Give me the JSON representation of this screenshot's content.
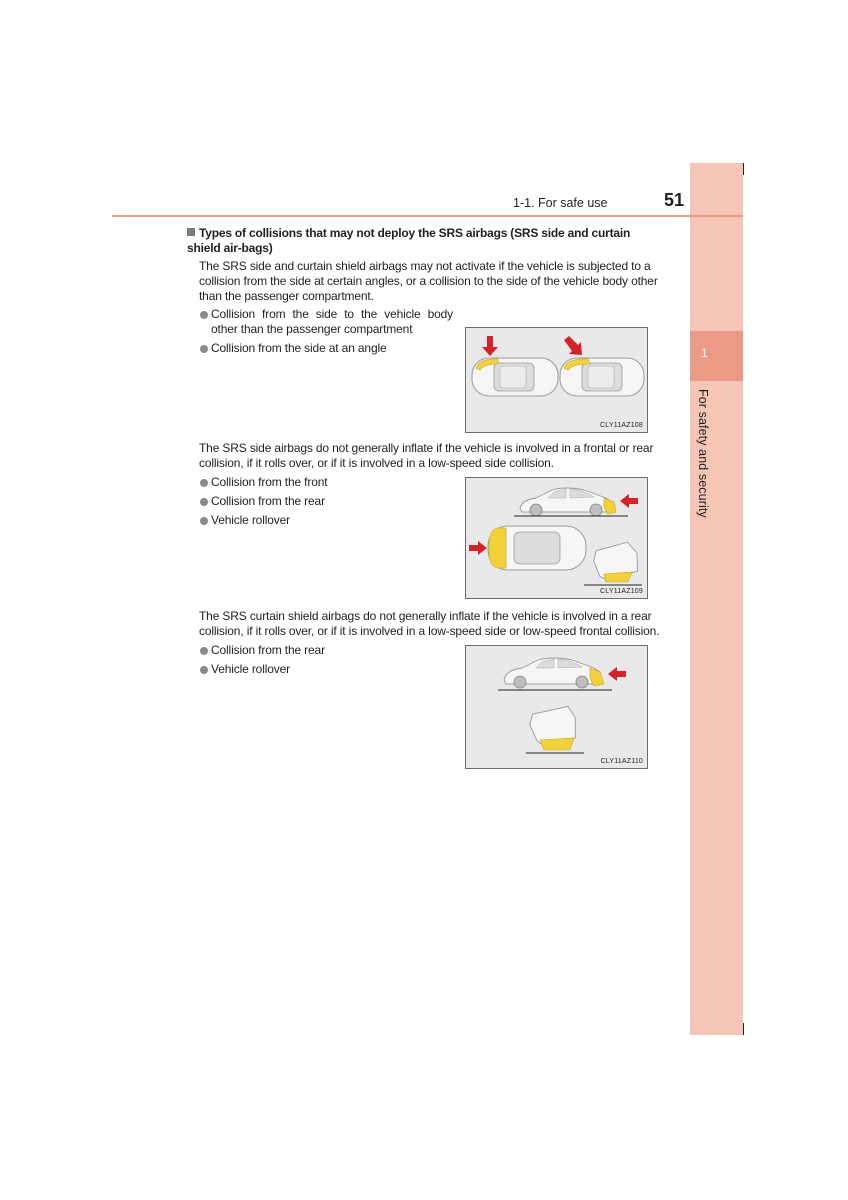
{
  "header": {
    "section": "1-1. For safe use",
    "page_number": "51"
  },
  "sidebar": {
    "chapter_number": "1",
    "chapter_title": "For safety and security"
  },
  "content": {
    "heading": "Types of collisions that may not deploy the SRS airbags (SRS side and curtain shield airbags)",
    "heading_display": "Types of collisions that may not deploy the SRS airbags (SRS side and curtain shield air-bags)",
    "sections": [
      {
        "paragraph": "The SRS side and curtain shield airbags may not activate if the vehicle is subjected to a collision from the side at certain angles, or a collision to the side of the vehicle body other than the passenger compartment.",
        "bullets": [
          "Collision from the side to the vehicle body other than the passenger compartment",
          "Collision from the side at an angle"
        ],
        "figure_code": "CLY11AZ108"
      },
      {
        "paragraph": "The SRS side airbags do not generally inflate if the vehicle is involved in a frontal or rear collision, if it rolls over, or if it is involved in a low-speed side collision.",
        "bullets": [
          "Collision from the front",
          "Collision from the rear",
          "Vehicle rollover"
        ],
        "figure_code": "CLY11AZ109"
      },
      {
        "paragraph": "The SRS curtain shield airbags do not generally inflate if the vehicle is involved in a rear collision, if it rolls over, or if it is involved in a low-speed side or low-speed frontal collision.",
        "bullets": [
          "Collision from the rear",
          "Vehicle rollover"
        ],
        "figure_code": "CLY11AZ110"
      }
    ]
  },
  "colors": {
    "accent": "#eb9a86",
    "sidebar": "#f5c6b6",
    "impact_arrow": "#d2232a",
    "impact_zone": "#f2d23c",
    "figure_bg": "#e9e9ea"
  }
}
